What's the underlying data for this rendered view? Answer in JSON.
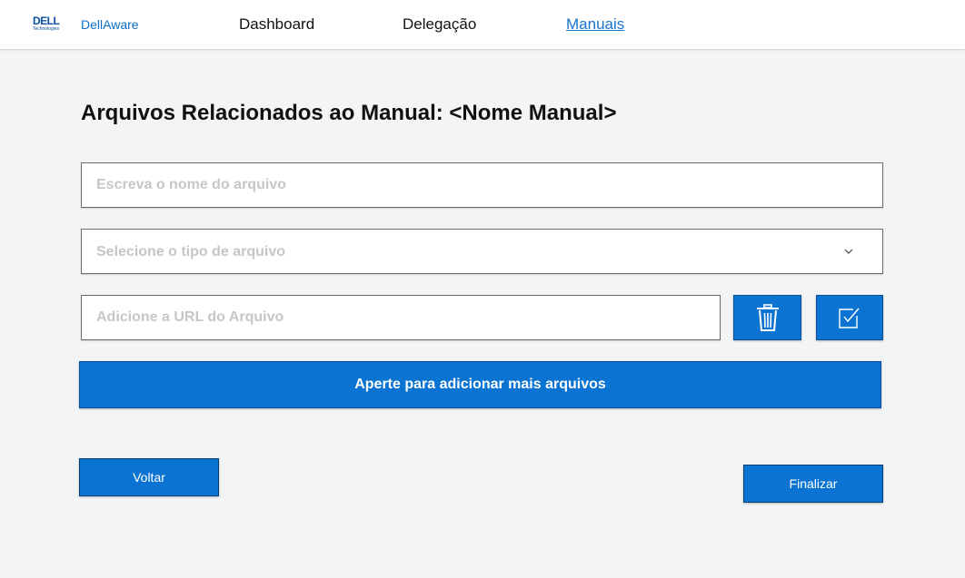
{
  "header": {
    "logo_text": "DELL",
    "logo_subtext": "Technologies",
    "brand": "DellAware",
    "nav": [
      {
        "label": "Dashboard",
        "active": false
      },
      {
        "label": "Delegação",
        "active": false
      },
      {
        "label": "Manuais",
        "active": true
      }
    ]
  },
  "main": {
    "title": "Arquivos Relacionados ao Manual: <Nome Manual>",
    "file_name": {
      "value": "",
      "placeholder": "Escreva o nome do arquivo"
    },
    "file_type": {
      "selected": "Selecione o tipo de arquivo"
    },
    "file_url": {
      "value": "",
      "placeholder": "Adicione a URL do Arquivo"
    },
    "delete_icon": "trash-icon",
    "confirm_icon": "checkbox-check-icon",
    "add_more_label": "Aperte para adicionar mais arquivos"
  },
  "footer": {
    "back_label": "Voltar",
    "finish_label": "Finalizar"
  },
  "colors": {
    "accent": "#0b73d1",
    "active_link": "#1a73c8",
    "background": "#f3f4f6"
  }
}
